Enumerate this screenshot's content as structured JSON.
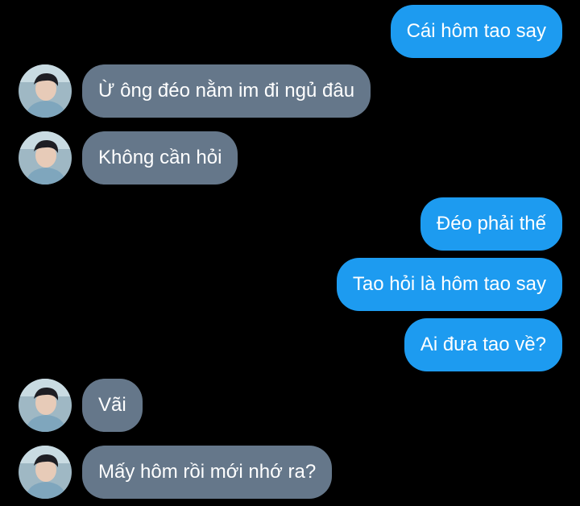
{
  "conversation": {
    "messages": [
      {
        "direction": "sent",
        "text": "Cái hôm tao say"
      },
      {
        "direction": "received",
        "text": "Ừ ông đéo nằm im đi ngủ đâu"
      },
      {
        "direction": "received",
        "text": "Không cần hỏi"
      },
      {
        "direction": "sent",
        "text": "Đéo phải thế"
      },
      {
        "direction": "sent",
        "text": "Tao hỏi là hôm tao say"
      },
      {
        "direction": "sent",
        "text": "Ai đưa tao về?"
      },
      {
        "direction": "received",
        "text": "Vãi"
      },
      {
        "direction": "received",
        "text": "Mấy hôm rồi mới nhớ ra?"
      }
    ]
  },
  "colors": {
    "background": "#000000",
    "sent_bubble": "#1d9bf0",
    "received_bubble": "#65778a",
    "text": "#ffffff"
  }
}
